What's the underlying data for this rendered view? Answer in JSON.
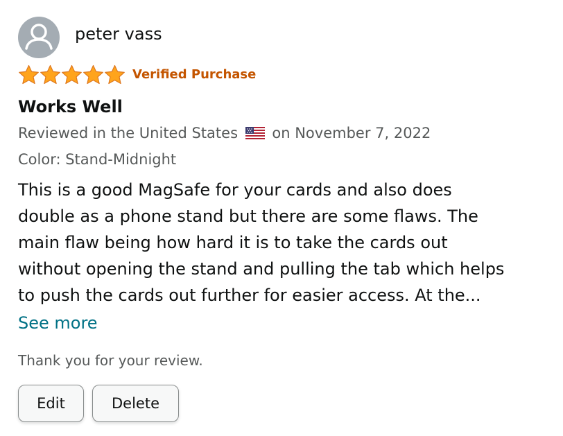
{
  "reviewer": {
    "name": "peter vass",
    "avatar_icon": "user-silhouette-icon"
  },
  "rating": {
    "stars": 5,
    "out_of": 5,
    "star_color": "#ffa41c",
    "verified_label": "Verified Purchase",
    "verified_color": "#c45500"
  },
  "review": {
    "title": "Works Well",
    "date_prefix": "Reviewed in the United States",
    "flag_icon": "us-flag-icon",
    "date_suffix": "on November 7, 2022",
    "variant": "Color: Stand-Midnight",
    "body_lines": [
      "This is a good MagSafe for your cards and also does",
      "double as a phone stand but there are some flaws. The",
      "main flaw being how hard it is to take the cards out",
      "without opening the stand and pulling the tab which helps",
      "to push the cards out further for easier access. At the..."
    ],
    "see_more_label": "See more",
    "link_color": "#007185"
  },
  "footer": {
    "thanks_text": "Thank you for your review.",
    "edit_label": "Edit",
    "delete_label": "Delete"
  }
}
